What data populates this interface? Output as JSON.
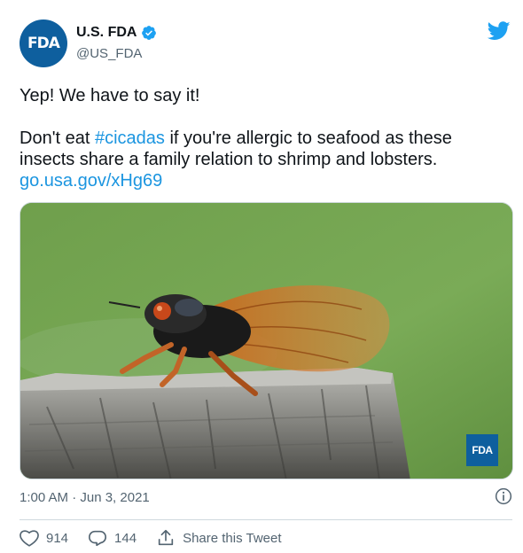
{
  "author": {
    "avatar_text": "FDA",
    "display_name": "U.S. FDA",
    "handle": "@US_FDA",
    "verified": true
  },
  "tweet": {
    "line1": "Yep! We have to say it!",
    "line2_before": "Don't eat ",
    "hashtag": "#cicadas",
    "line2_after": " if you're allergic to seafood as these insects share a family relation to shrimp and lobsters.",
    "link": "go.usa.gov/xHg69"
  },
  "media": {
    "badge_text": "FDA",
    "subject": "cicada on a wooden post"
  },
  "timestamp": "1:00 AM · Jun 3, 2021",
  "actions": {
    "likes": "914",
    "replies": "144",
    "share_label": "Share this Tweet"
  },
  "colors": {
    "link": "#1b95e0",
    "brand": "#0e5f9e",
    "twitter_blue": "#1da1f2",
    "secondary_text": "#536471"
  },
  "icons": [
    "twitter-bird-icon",
    "verified-badge-icon",
    "info-icon",
    "heart-icon",
    "reply-icon",
    "share-icon"
  ]
}
